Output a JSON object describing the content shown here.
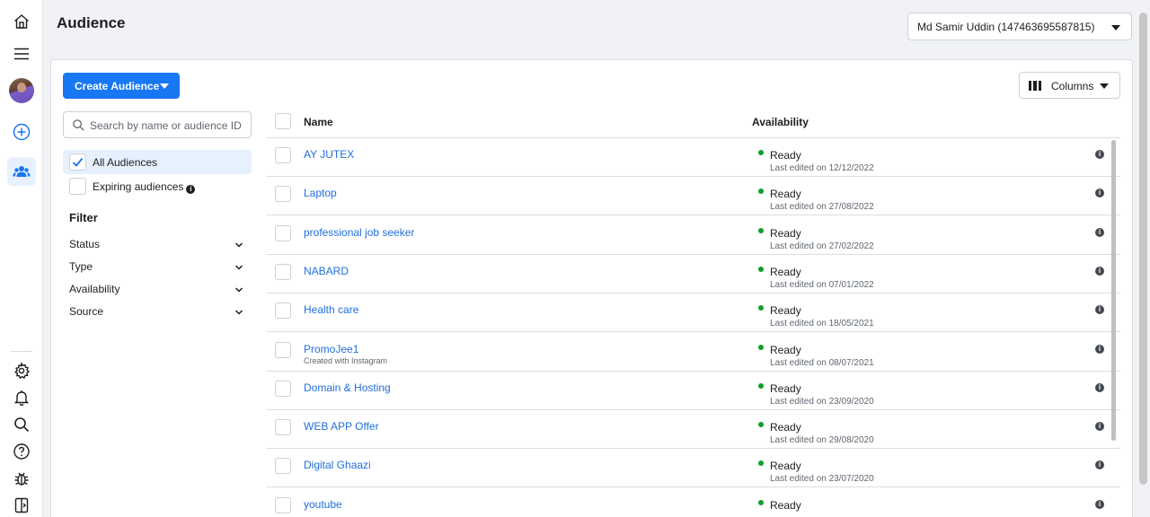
{
  "header": {
    "title": "Audience",
    "account": "Md Samir Uddin (147463695587815)"
  },
  "toolbar": {
    "create_label": "Create Audience",
    "columns_label": "Columns"
  },
  "search": {
    "placeholder": "Search by name or audience ID"
  },
  "audience_options": {
    "all": "All Audiences",
    "expiring": "Expiring audiences",
    "all_selected": true
  },
  "filter": {
    "title": "Filter",
    "items": [
      "Status",
      "Type",
      "Availability",
      "Source"
    ]
  },
  "table": {
    "columns": {
      "name": "Name",
      "availability": "Availability"
    },
    "rows": [
      {
        "name": "AY JUTEX",
        "sub": "",
        "status": "Ready",
        "edited": "Last edited on 12/12/2022"
      },
      {
        "name": "Laptop",
        "sub": "",
        "status": "Ready",
        "edited": "Last edited on 27/08/2022"
      },
      {
        "name": "professional job seeker",
        "sub": "",
        "status": "Ready",
        "edited": "Last edited on 27/02/2022"
      },
      {
        "name": "NABARD",
        "sub": "",
        "status": "Ready",
        "edited": "Last edited on 07/01/2022"
      },
      {
        "name": "Health care",
        "sub": "",
        "status": "Ready",
        "edited": "Last edited on 18/05/2021"
      },
      {
        "name": "PromoJee1",
        "sub": "Created with Instagram",
        "status": "Ready",
        "edited": "Last edited on 08/07/2021"
      },
      {
        "name": "Domain & Hosting",
        "sub": "",
        "status": "Ready",
        "edited": "Last edited on 23/09/2020"
      },
      {
        "name": "WEB APP Offer",
        "sub": "",
        "status": "Ready",
        "edited": "Last edited on 29/08/2020"
      },
      {
        "name": "Digital Ghaazi",
        "sub": "",
        "status": "Ready",
        "edited": "Last edited on 23/07/2020"
      },
      {
        "name": "youtube",
        "sub": "",
        "status": "Ready",
        "edited": ""
      }
    ]
  },
  "colors": {
    "accent": "#1877f2",
    "link": "#216fdb",
    "ready": "#0f9d2c"
  },
  "icons": {
    "rail": [
      "home-icon",
      "menu-icon",
      "avatar",
      "add-circle-icon",
      "audience-icon",
      "settings-icon",
      "bell-icon",
      "search-icon",
      "help-icon",
      "bug-icon",
      "side-panel-icon"
    ]
  }
}
